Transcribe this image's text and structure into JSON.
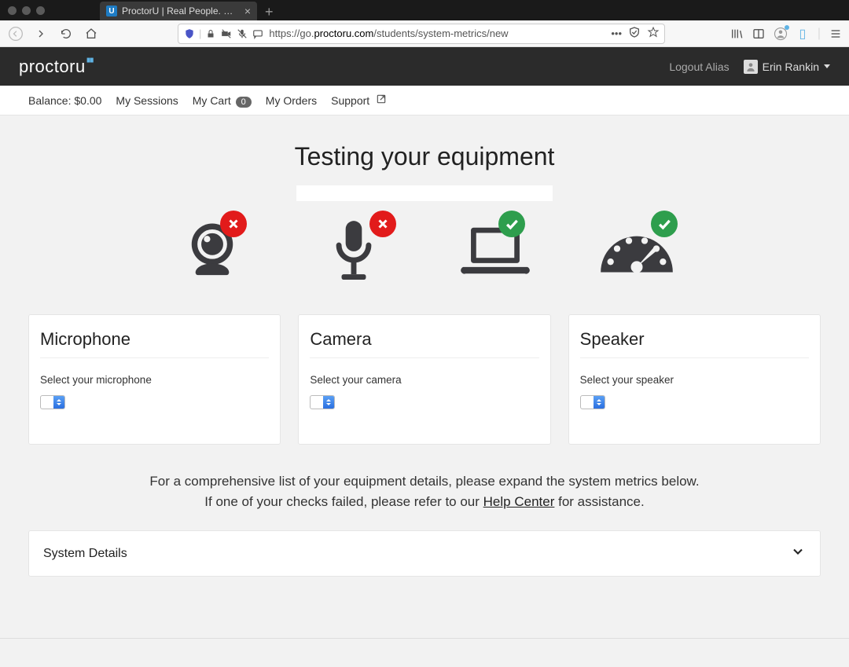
{
  "browser": {
    "tab_title": "ProctorU | Real People. Real Pr…",
    "url_prefix": "https://go.",
    "url_domain": "proctoru.com",
    "url_path": "/students/system-metrics/new"
  },
  "header": {
    "logo_text": "proctor",
    "logo_suffix": "u",
    "logout_label": "Logout Alias",
    "username": "Erin Rankin"
  },
  "nav": {
    "balance_label": "Balance: $0.00",
    "sessions_label": "My Sessions",
    "cart_label": "My Cart",
    "cart_count": "0",
    "orders_label": "My Orders",
    "support_label": "Support"
  },
  "page": {
    "title": "Testing your equipment",
    "status": {
      "camera": "fail",
      "microphone": "fail",
      "computer": "pass",
      "speed": "pass"
    },
    "cards": {
      "mic": {
        "title": "Microphone",
        "label": "Select your microphone"
      },
      "cam": {
        "title": "Camera",
        "label": "Select your camera"
      },
      "spk": {
        "title": "Speaker",
        "label": "Select your speaker"
      }
    },
    "help_line1": "For a comprehensive list of your equipment details, please expand the system metrics below.",
    "help_line2a": "If one of your checks failed, please refer to our ",
    "help_link": "Help Center",
    "help_line2b": " for assistance.",
    "expander_label": "System Details"
  }
}
